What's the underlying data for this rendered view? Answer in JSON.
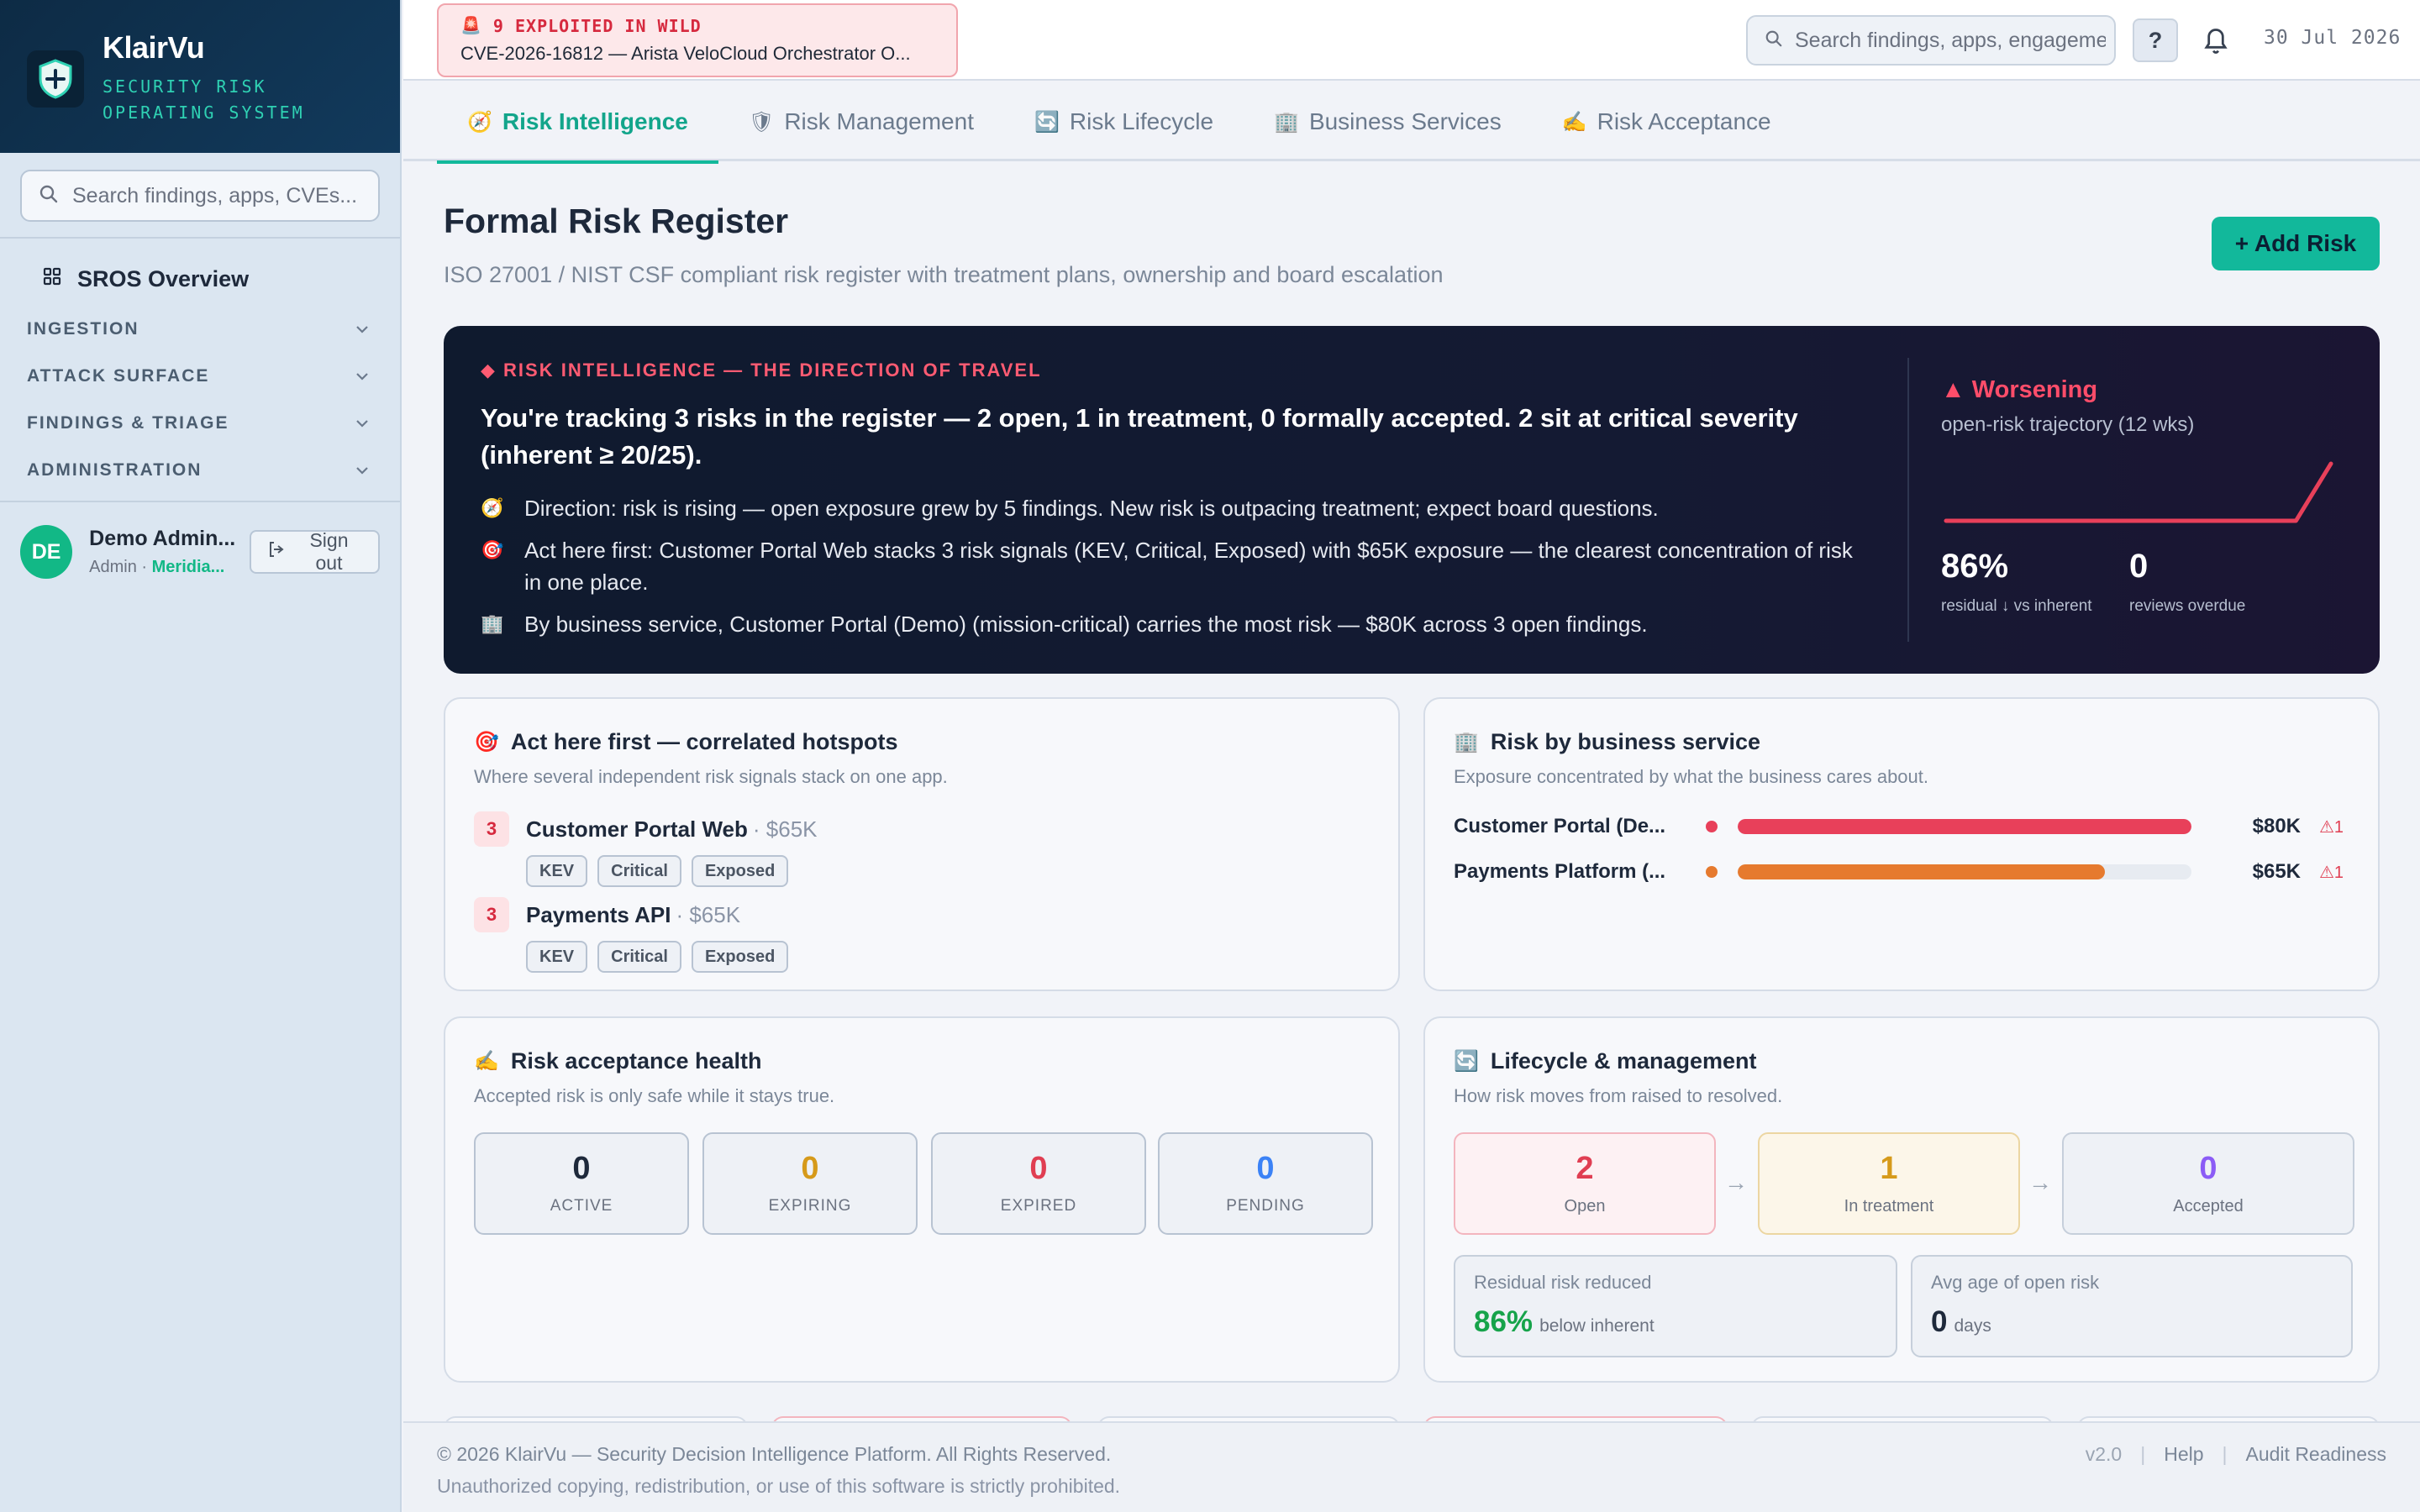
{
  "brand": {
    "name": "KlairVu",
    "tagline": "SECURITY RISK OPERATING SYSTEM",
    "logo_icon": "shield-plus-icon"
  },
  "sidebar": {
    "search_placeholder": "Search findings, apps, CVEs...",
    "overview_label": "SROS Overview",
    "groups": [
      {
        "label": "INGESTION"
      },
      {
        "label": "ATTACK SURFACE"
      },
      {
        "label": "FINDINGS & TRIAGE"
      },
      {
        "label": "ADMINISTRATION"
      }
    ],
    "user": {
      "initials": "DE",
      "name": "Demo Admin...",
      "role": "Admin",
      "org": "Meridia...",
      "signout_label": "Sign out"
    }
  },
  "topbar": {
    "alert_title": "9 EXPLOITED IN WILD",
    "alert_cve": "CVE-2026-16812 — Arista VeloCloud Orchestrator O...",
    "search_placeholder": "Search findings, apps, engagements...",
    "help_label": "?",
    "date": "30 Jul 2026"
  },
  "tabs": [
    {
      "label": "Risk Intelligence",
      "icon": "🧭",
      "active": true
    },
    {
      "label": "Risk Management",
      "icon": "🛡",
      "active": false
    },
    {
      "label": "Risk Lifecycle",
      "icon": "🔄",
      "active": false
    },
    {
      "label": "Business Services",
      "icon": "🏢",
      "active": false
    },
    {
      "label": "Risk Acceptance",
      "icon": "✍️",
      "active": false
    }
  ],
  "header": {
    "title": "Formal Risk Register",
    "subtitle": "ISO 27001 / NIST CSF compliant risk register with treatment plans, ownership and board escalation",
    "add_button": "+ Add Risk"
  },
  "intel": {
    "kicker": "◆ RISK INTELLIGENCE — THE DIRECTION OF TRAVEL",
    "headline": "You're tracking 3 risks in the register — 2 open, 1 in treatment, 0 formally accepted. 2 sit at critical severity (inherent ≥ 20/25).",
    "bullets": [
      {
        "icon": "🧭",
        "text": "Direction: risk is rising — open exposure grew by 5 findings. New risk is outpacing treatment; expect board questions."
      },
      {
        "icon": "🎯",
        "text": "Act here first: Customer Portal Web stacks 3 risk signals (KEV, Critical, Exposed) with $65K exposure — the clearest concentration of risk in one place."
      },
      {
        "icon": "🏢",
        "text": "By business service, Customer Portal (Demo) (mission-critical) carries the most risk — $80K across 3 open findings."
      }
    ],
    "trend_label": "▲ Worsening",
    "trajectory_label": "open-risk trajectory (12 wks)",
    "trajectory": [
      0,
      0,
      0,
      0,
      0,
      0,
      0,
      0,
      0,
      0,
      0,
      5
    ],
    "residual_value": "86%",
    "residual_label": "residual ↓ vs inherent",
    "overdue_value": "0",
    "overdue_label": "reviews overdue",
    "colors": {
      "alert": "#ff4d6a"
    }
  },
  "hotspots": {
    "title": "Act here first — correlated hotspots",
    "icon": "🎯",
    "subtitle": "Where several independent risk signals stack on one app.",
    "items": [
      {
        "count": "3",
        "name": "Customer Portal Web",
        "exposure": "· $65K",
        "tags": [
          "KEV",
          "Critical",
          "Exposed"
        ]
      },
      {
        "count": "3",
        "name": "Payments API",
        "exposure": "· $65K",
        "tags": [
          "KEV",
          "Critical",
          "Exposed"
        ]
      }
    ]
  },
  "services": {
    "title": "Risk by business service",
    "icon": "🏢",
    "subtitle": "Exposure concentrated by what the business cares about.",
    "items": [
      {
        "name": "Customer Portal (De...",
        "value": "$80K",
        "flag": "⚠1",
        "fraction": 1.0,
        "color": "#e8405a"
      },
      {
        "name": "Payments Platform (...",
        "value": "$65K",
        "flag": "⚠1",
        "fraction": 0.81,
        "color": "#e67a2e"
      }
    ]
  },
  "acceptance": {
    "title": "Risk acceptance health",
    "icon": "✍️",
    "subtitle": "Accepted risk is only safe while it stays true.",
    "items": [
      {
        "value": "0",
        "label": "ACTIVE",
        "color": "#1e293b"
      },
      {
        "value": "0",
        "label": "EXPIRING",
        "color": "#d69a1a"
      },
      {
        "value": "0",
        "label": "EXPIRED",
        "color": "#e03e52"
      },
      {
        "value": "0",
        "label": "PENDING",
        "color": "#3b82f6"
      }
    ]
  },
  "lifecycle": {
    "title": "Lifecycle & management",
    "icon": "🔄",
    "subtitle": "How risk moves from raised to resolved.",
    "stages": [
      {
        "value": "2",
        "label": "Open",
        "color": "#e03e52"
      },
      {
        "value": "1",
        "label": "In treatment",
        "color": "#d69a1a"
      },
      {
        "value": "0",
        "label": "Accepted",
        "color": "#8b5cf6"
      }
    ],
    "arrow": "→",
    "residual": {
      "label": "Residual risk reduced",
      "value": "86%",
      "unit": "below inherent"
    },
    "avg_age": {
      "label": "Avg age of open risk",
      "value": "0",
      "unit": "days"
    }
  },
  "footer": {
    "copyright": "© 2026 KlairVu — Security Decision Intelligence Platform. All Rights Reserved.",
    "notice": "Unauthorized copying, redistribution, or use of this software is strictly prohibited.",
    "version": "v2.0",
    "help": "Help",
    "audit": "Audit Readiness",
    "sep": "|"
  }
}
